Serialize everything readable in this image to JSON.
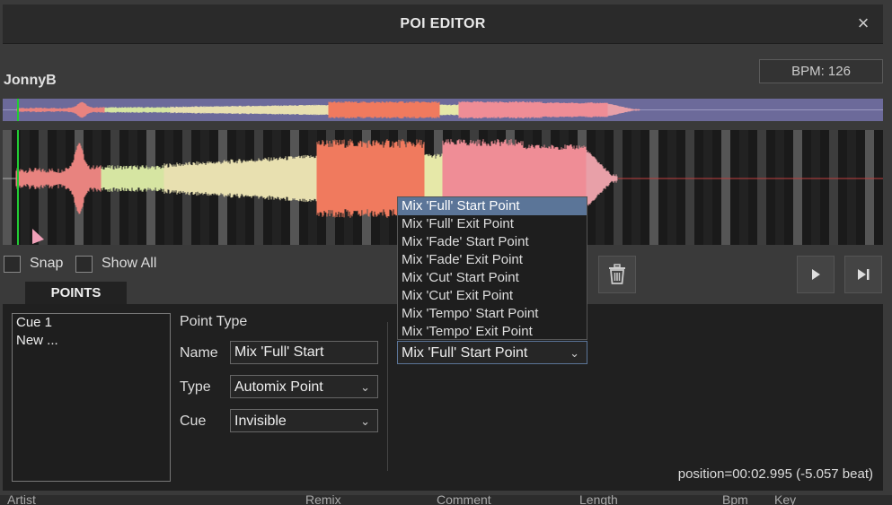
{
  "window": {
    "title": "POI EDITOR",
    "close_icon": "×"
  },
  "track": {
    "title": "JonnyB",
    "bpm": "BPM: 126"
  },
  "options": {
    "snap_label": "Snap",
    "show_all_label": "Show All"
  },
  "tabs": [
    {
      "label": "POINTS"
    }
  ],
  "points_list": {
    "items": [
      "Cue 1",
      "New ..."
    ]
  },
  "form": {
    "point_type_label": "Point Type",
    "name_label": "Name",
    "name_value": "Mix 'Full' Start",
    "type_label": "Type",
    "type_value": "Automix Point",
    "cue_label": "Cue",
    "cue_value": "Invisible",
    "point_select_value": "Mix 'Full' Start Point"
  },
  "dropdown": {
    "options": [
      "Mix 'Full' Start Point",
      "Mix 'Full' Exit Point",
      "Mix 'Fade' Start Point",
      "Mix 'Fade' Exit Point",
      "Mix 'Cut' Start Point",
      "Mix 'Cut' Exit Point",
      "Mix 'Tempo' Start Point",
      "Mix 'Tempo' Exit Point"
    ],
    "selected_index": 0
  },
  "status": {
    "position": "position=00:02.995 (-5.057 beat)"
  },
  "bottom_columns": [
    "Artist",
    "Remix",
    "Comment",
    "Length",
    "Bpm",
    "Key"
  ],
  "colors": {
    "waveform_overview_bg": "#6c6a9a",
    "dropdown_selected": "#5b7598",
    "playhead": "#22cc33",
    "panel_bg": "#202020"
  }
}
